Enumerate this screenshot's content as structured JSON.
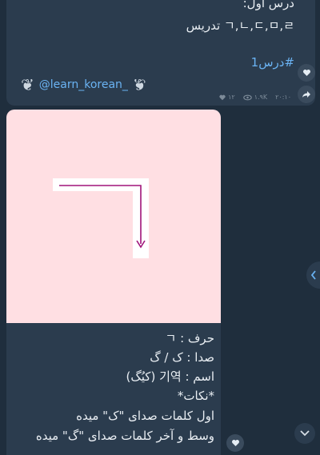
{
  "post1": {
    "line1": "درس اول:",
    "line2": "ㄱ,ㄴ,ㄷ,ㅁ,ㄹ تدریس",
    "hashtag": "#درس1",
    "handle": "@learn_korean_",
    "flourish_left": "❦",
    "flourish_right": "❦",
    "likes": "۱۲",
    "views": "۱.۹K",
    "time": "۲۰:۱۰"
  },
  "post2": {
    "lines": [
      "حرف : ㄱ",
      "صدا : ک / گ",
      "اسم : 기역 (کیُگ)",
      "*نکات*",
      "اول کلمات صدای \"ک\" میده",
      "وسط و آخر کلمات صدای \"گ\" میده"
    ],
    "image_background": "#ffdfe3",
    "stroke_color": "#a0147a"
  },
  "icons": {
    "react": "heart-icon",
    "share": "share-icon",
    "views": "eye-icon",
    "scroll_down": "chevron-down-icon",
    "collapse": "chevron-left-icon"
  },
  "colors": {
    "background": "#1f2e3d",
    "bubble": "#2b3c4e",
    "link": "#6ab3f3"
  }
}
